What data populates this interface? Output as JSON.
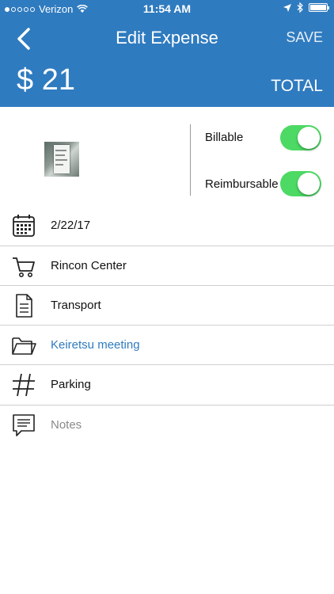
{
  "status_bar": {
    "carrier": "Verizon",
    "time": "11:54 AM"
  },
  "header": {
    "title": "Edit Expense",
    "save_label": "SAVE",
    "amount": "$ 21",
    "total_label": "TOTAL",
    "background_color": "#2f7bbf"
  },
  "toggles": [
    {
      "label": "Billable",
      "on": true
    },
    {
      "label": "Reimbursable",
      "on": true
    }
  ],
  "toggle_color": "#4cd964",
  "fields": {
    "date": "2/22/17",
    "merchant": "Rincon Center",
    "category": "Transport",
    "project": "Keiretsu meeting",
    "tag": "Parking",
    "notes_placeholder": "Notes"
  },
  "project_color": "#2f7bbf",
  "icons": [
    "calendar-icon",
    "cart-icon",
    "document-icon",
    "folder-icon",
    "hashtag-icon",
    "chat-icon"
  ]
}
